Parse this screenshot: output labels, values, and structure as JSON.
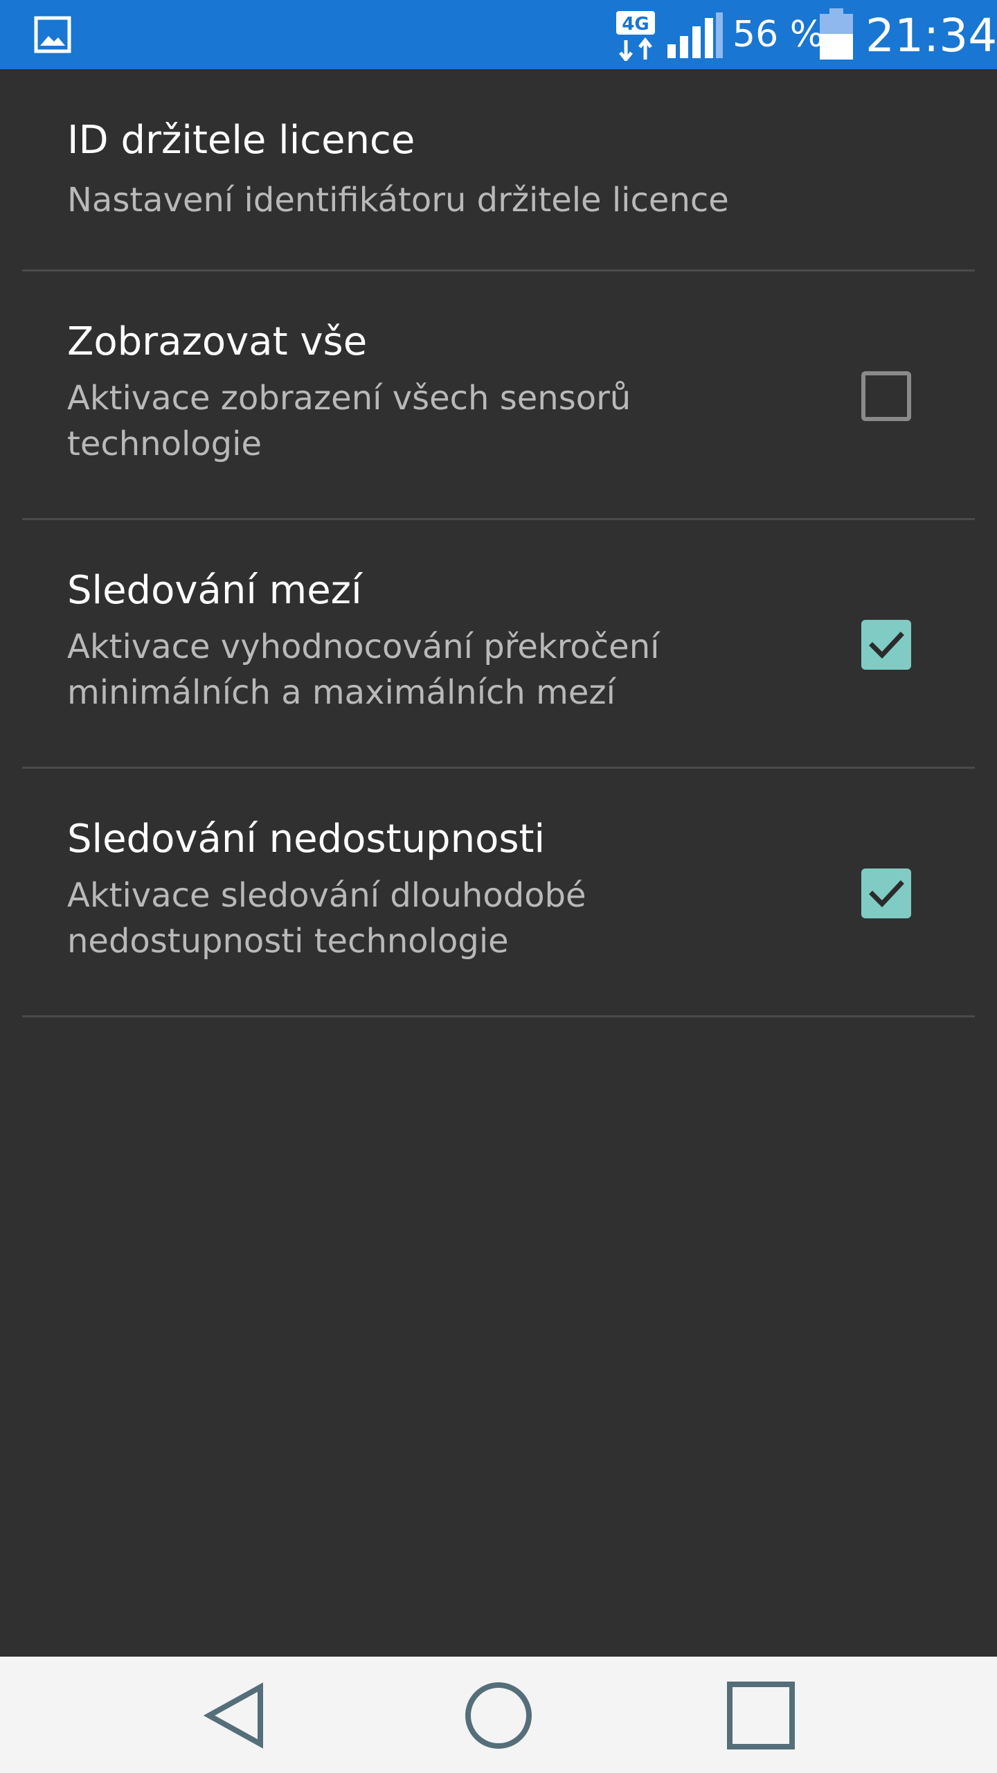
{
  "status_bar": {
    "network_type": "4G",
    "battery_percent": "56 %",
    "battery_level": 0.56,
    "time": "21:34",
    "colors": {
      "background": "#1976D2",
      "foreground": "#ffffff"
    },
    "icons": [
      "gallery-icon",
      "data-transfer-icon",
      "signal-icon",
      "battery-icon"
    ]
  },
  "settings": {
    "items": [
      {
        "title": "ID držitele licence",
        "summary": "Nastavení identifikátoru držitele licence"
      },
      {
        "title": "Zobrazovat vše",
        "summary": "Aktivace zobrazení všech sensorů technologie",
        "checked": false
      },
      {
        "title": "Sledování mezí",
        "summary": "Aktivace vyhodnocování překročení minimálních a maximálních mezí",
        "checked": true
      },
      {
        "title": "Sledování nedostupnosti",
        "summary": "Aktivace sledování dlouhodobé nedostupnosti technologie",
        "checked": true
      }
    ],
    "colors": {
      "background": "#303030",
      "title": "#ffffff",
      "summary": "#b9b9b9",
      "divider": "#4a4a4a",
      "checkbox_checked": "#80CBC4",
      "checkbox_unchecked_border": "#8a8a8a"
    }
  },
  "nav_bar": {
    "icons": [
      "back-icon",
      "home-icon",
      "recent-apps-icon"
    ],
    "colors": {
      "background": "#f4f4f4",
      "icon": "#546E7A"
    }
  }
}
